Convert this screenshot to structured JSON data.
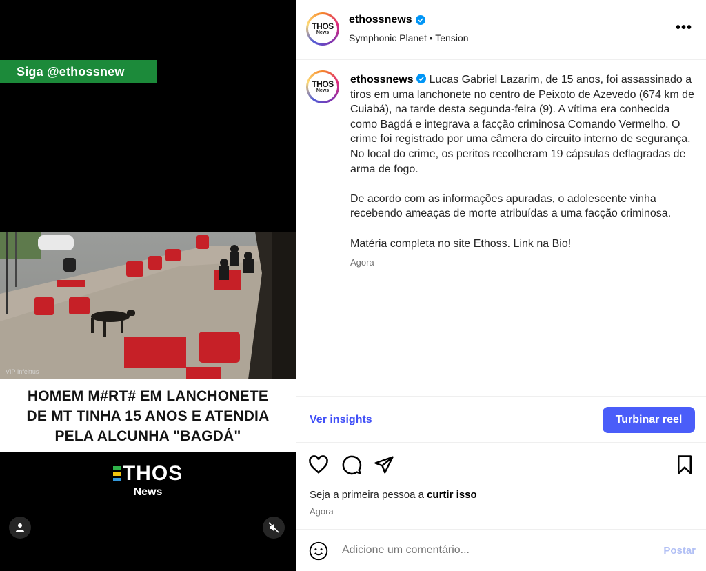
{
  "media": {
    "follow_banner": "Siga @ethossnew",
    "video_watermark": "VIP Infelttus",
    "headline_lines": [
      "HOMEM M#RT# EM LANCHONETE",
      "DE MT TINHA 15 ANOS E ATENDIA",
      "PELA ALCUNHA \"BAGDÁ\""
    ],
    "logo_big": "THOS",
    "logo_small": "News",
    "accent_green": "#1c8a3a"
  },
  "header": {
    "avatar_text": "THOS",
    "avatar_sub": "News",
    "username": "ethossnews",
    "audio": "Symphonic Planet • Tension",
    "more_icon": "more-horizontal-icon"
  },
  "caption": {
    "username": "ethossnews",
    "paragraphs": [
      "Lucas Gabriel Lazarim, de 15 anos, foi assassinado a tiros em uma lanchonete no centro de Peixoto de Azevedo (674 km de Cuiabá), na tarde desta segunda-feira (9). A vítima era conhecida como Bagdá e integrava a facção criminosa Comando Vermelho. O crime foi registrado por uma câmera do circuito interno de segurança. No local do crime, os peritos recolheram 19 cápsulas deflagradas de arma de fogo.",
      "De acordo com as informações apuradas, o adolescente vinha recebendo ameaças de morte atribuídas a uma facção criminosa.",
      "Matéria completa no site Ethoss. Link na Bio!"
    ],
    "time": "Agora"
  },
  "insights": {
    "link": "Ver insights",
    "boost": "Turbinar reel",
    "accent": "#4a5df9"
  },
  "likes": {
    "prefix": "Seja a primeira pessoa a ",
    "action": "curtir isso",
    "time": "Agora"
  },
  "comment": {
    "placeholder": "Adicione um comentário...",
    "post": "Postar"
  }
}
